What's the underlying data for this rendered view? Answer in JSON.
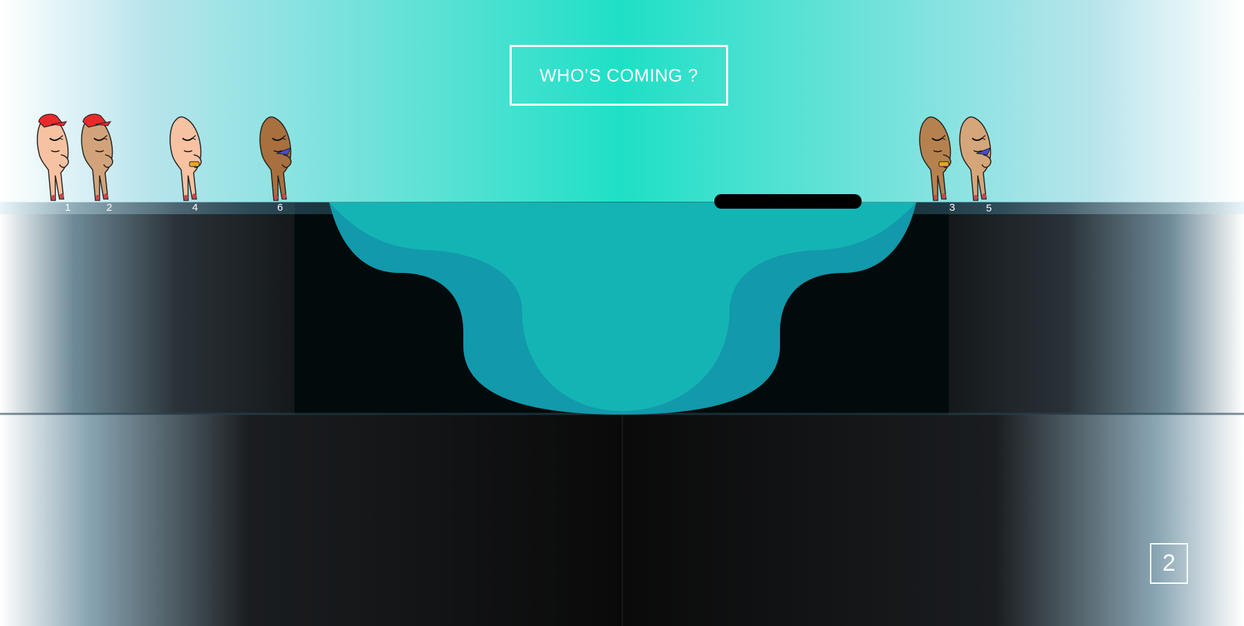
{
  "game": {
    "title_button": "WHO’S COMING ?",
    "level": "2"
  },
  "characters": {
    "left": [
      {
        "number": "1",
        "skin": "#f7c2a2",
        "hat": true,
        "accessory": "none"
      },
      {
        "number": "2",
        "skin": "#d2a37a",
        "hat": true,
        "accessory": "none"
      },
      {
        "number": "4",
        "skin": "#f7c2a2",
        "hat": false,
        "accessory": "gold-ring"
      },
      {
        "number": "6",
        "skin": "#a8703e",
        "hat": false,
        "accessory": "blue-ring"
      }
    ],
    "right": [
      {
        "number": "3",
        "skin": "#b5824f",
        "hat": false,
        "accessory": "gold-ring"
      },
      {
        "number": "5",
        "skin": "#d4a67a",
        "hat": false,
        "accessory": "blue-ring"
      }
    ]
  },
  "colors": {
    "sky_center": "#1ee0c6",
    "water_light": "#14b4b4",
    "water_dark": "#1299ab",
    "ground": "#0a0a0a",
    "raft": "#000000",
    "hat": "#e82a2a"
  }
}
